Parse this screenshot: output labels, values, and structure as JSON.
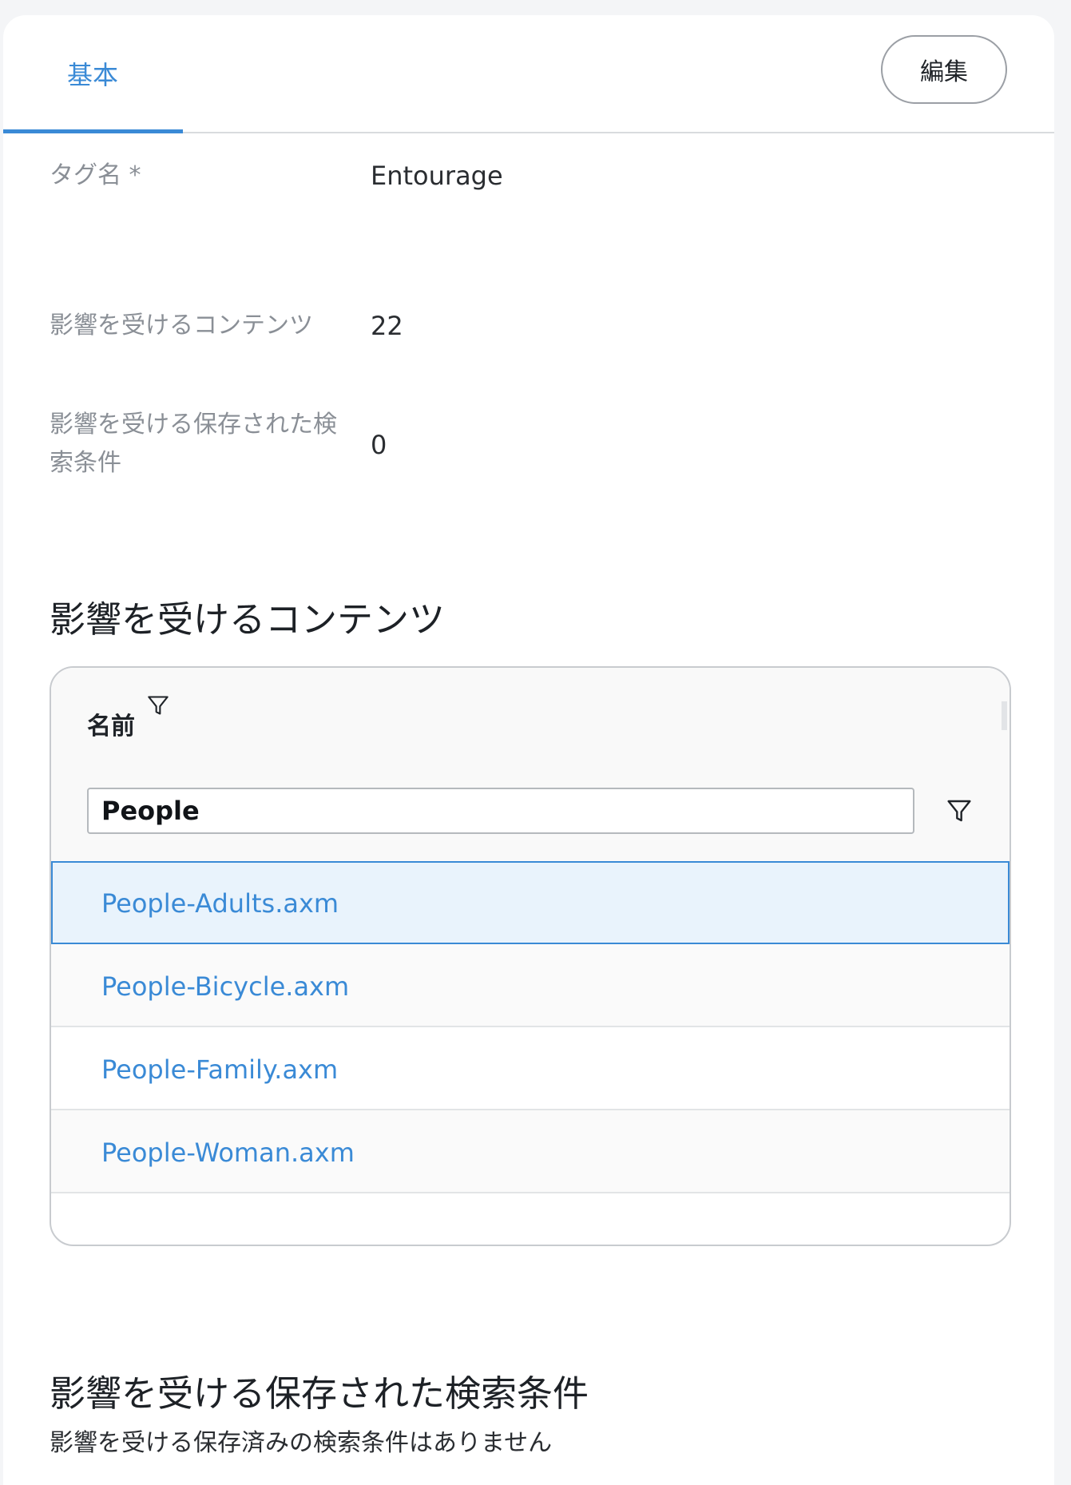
{
  "tabs": [
    {
      "label": "基本",
      "active": true
    }
  ],
  "edit_label": "編集",
  "fields": {
    "tag_name_label": "タグ名 *",
    "tag_name_value": "Entourage",
    "affected_content_label": "影響を受けるコンテンツ",
    "affected_content_value": "22",
    "affected_saved_search_label_line1": "影響を受ける保存された検",
    "affected_saved_search_label_line2": "索条件",
    "affected_saved_search_value": "0"
  },
  "content_section": {
    "title": "影響を受けるコンテンツ",
    "column_header": "名前",
    "filter_value": "People",
    "rows": [
      {
        "name": "People-Adults.axm",
        "selected": true
      },
      {
        "name": "People-Bicycle.axm",
        "selected": false
      },
      {
        "name": "People-Family.axm",
        "selected": false
      },
      {
        "name": "People-Woman.axm",
        "selected": false
      }
    ]
  },
  "saved_search_section": {
    "title": "影響を受ける保存された検索条件",
    "empty_message": "影響を受ける保存済みの検索条件はありません"
  },
  "colors": {
    "accent": "#3a8ad6",
    "selected_row_bg": "#e9f3fc",
    "label_gray": "#8a8f96"
  },
  "icons": {
    "column_filter": "filter-funnel-icon",
    "input_filter": "filter-funnel-icon"
  }
}
